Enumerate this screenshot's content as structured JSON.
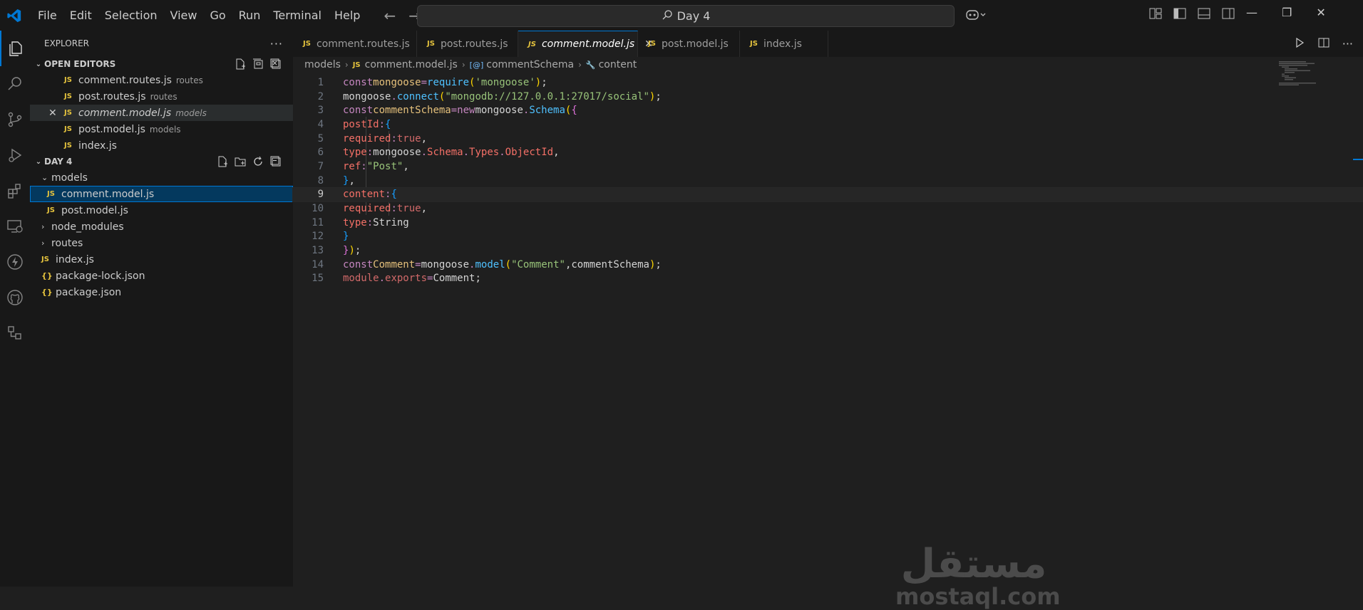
{
  "titlebar": {
    "menu": [
      "File",
      "Edit",
      "Selection",
      "View",
      "Go",
      "Run",
      "Terminal",
      "Help"
    ],
    "search_text": "Day 4"
  },
  "sidebar": {
    "title": "EXPLORER",
    "open_editors_label": "OPEN EDITORS",
    "open_editors": [
      {
        "name": "comment.routes.js",
        "desc": "routes"
      },
      {
        "name": "post.routes.js",
        "desc": "routes"
      },
      {
        "name": "comment.model.js",
        "desc": "models"
      },
      {
        "name": "post.model.js",
        "desc": "models"
      },
      {
        "name": "index.js",
        "desc": ""
      }
    ],
    "folder_label": "DAY 4",
    "tree": {
      "models": "models",
      "comment_model": "comment.model.js",
      "post_model": "post.model.js",
      "node_modules": "node_modules",
      "routes": "routes",
      "index": "index.js",
      "package_lock": "package-lock.json",
      "package": "package.json"
    }
  },
  "tabs": [
    "comment.routes.js",
    "post.routes.js",
    "comment.model.js",
    "post.model.js",
    "index.js"
  ],
  "breadcrumb": {
    "folder": "models",
    "file": "comment.model.js",
    "symbol": "commentSchema",
    "property": "content"
  },
  "code": {
    "line_numbers": [
      "1",
      "2",
      "3",
      "4",
      "5",
      "6",
      "7",
      "8",
      "9",
      "10",
      "11",
      "12",
      "13",
      "14",
      "15"
    ],
    "current_line": 9
  },
  "watermark": {
    "arabic": "مستقل",
    "latin": "mostaql.com"
  },
  "colors": {
    "accent": "#0078d4",
    "js_icon": "#e5c33d",
    "keyword": "#c586c0"
  }
}
